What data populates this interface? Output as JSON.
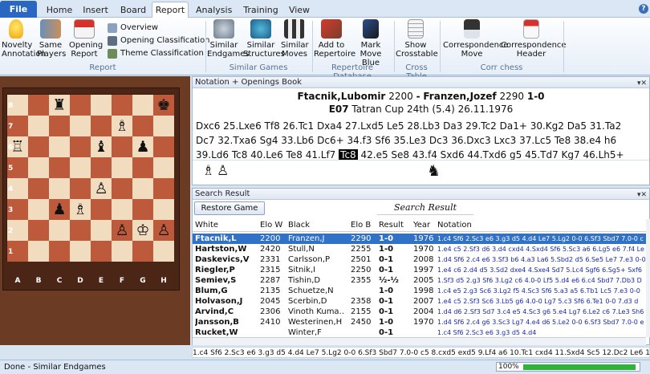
{
  "tabs": [
    "File",
    "Home",
    "Insert",
    "Board",
    "Report",
    "Analysis",
    "Training",
    "View"
  ],
  "help": "?",
  "ribbon": {
    "novelty": "Novelty Annotation",
    "same_players": "Same Players",
    "opening_report": "Opening Report",
    "overview": "Overview",
    "opening_classification": "Opening Classification",
    "theme_classification": "Theme Classification",
    "group_report": "Report",
    "similar_endgames": "Similar Endgames",
    "similar_structures": "Similar Structures",
    "similar_moves": "Similar Moves",
    "group_similar": "Similar Games",
    "add_repertoire": "Add to Repertoire",
    "mark_move_blue": "Mark Move Blue",
    "group_repertoire": "Repertoire Database",
    "show_crosstable": "Show Crosstable",
    "group_cross": "Cross Table",
    "corr_move": "Correspondence Move",
    "corr_header": "Correspondence Header",
    "group_corr": "Corr chess"
  },
  "board": {
    "ranks": [
      "8",
      "7",
      "6",
      "5",
      "4",
      "3",
      "2",
      "1"
    ],
    "files": [
      "A",
      "B",
      "C",
      "D",
      "E",
      "F",
      "G",
      "H"
    ]
  },
  "notation": {
    "title": "Notation + Openings Book",
    "white": "Ftacnik,Lubomir",
    "welo": "2200",
    "sep": "-",
    "black": "Franzen,Jozef",
    "belo": "2290",
    "result": "1-0",
    "eco": "E07",
    "event": "Tatran Cup 24th (5.4) 26.11.1976",
    "moves_a": "Dxc6 25.Lxe6 Tf8 26.Tc1 Dxa4 27.Lxd5 Le5 28.Lb3 Da3 29.Tc2 Da1+ 30.Kg2 Da5 31.Ta2",
    "moves_b": "Dc7 32.Txa6 Sg4 33.Lb6 Dc6+ 34.f3 Sf6 35.Le3 Dc3 36.Dxc3 Lxc3 37.Lc5 Te8 38.e4 h6",
    "moves_c1": "39.Ld6 Tc8 40.Le6 Te8 41.Lf7",
    "current": "Tc8",
    "moves_c2": "42.e5 Se8 43.f4 Sxd6 44.Txd6 g5 45.Td7 Kg7 46.Lh5+"
  },
  "search": {
    "title": "Search Result",
    "restore": "Restore Game",
    "result_title": "Search Result",
    "columns": [
      "White",
      "Elo W",
      "Black",
      "Elo B",
      "Result",
      "Year",
      "Notation"
    ],
    "rows": [
      [
        "Ftacnik,L",
        "2200",
        "Franzen,J",
        "2290",
        "1-0",
        "1976",
        "1.c4 Sf6 2.Sc3 e6 3.g3 d5 4.d4 Le7 5.Lg2 0-0 6.Sf3 Sbd7 7.0-0 c"
      ],
      [
        "Hartston,W",
        "2420",
        "Stull,N",
        "2255",
        "1-0",
        "1970",
        "1.e4 c5 2.Sf3 d6 3.d4 cxd4 4.Sxd4 Sf6 5.Sc3 a6 6.Lg5 e6 7.f4 Le"
      ],
      [
        "Daskevics,V",
        "2331",
        "Carlsson,P",
        "2501",
        "0-1",
        "2008",
        "1.d4 Sf6 2.c4 e6 3.Sf3 b6 4.a3 La6 5.Sbd2 d5 6.Se5 Le7 7.e3 0-0"
      ],
      [
        "Riegler,P",
        "2315",
        "Sitnik,I",
        "2250",
        "0-1",
        "1997",
        "1.e4 c6 2.d4 d5 3.Sd2 dxe4 4.Sxe4 Sd7 5.Lc4 Sgf6 6.Sg5+ Sxf6"
      ],
      [
        "Semiev,S",
        "2287",
        "Tishin,D",
        "2355",
        "½-½",
        "2005",
        "1.Sf3 d5 2.g3 Sf6 3.Lg2 c6 4.0-0 Lf5 5.d4 e6 6.c4 Sbd7 7.Db3 D"
      ],
      [
        "Blum,G",
        "2135",
        "Schuetze,N",
        "",
        "1-0",
        "1998",
        "1.c4 e5 2.g3 Sc6 3.Lg2 f5 4.Sc3 Sf6 5.a3 a5 6.Tb1 Lc5 7.e3 0-0"
      ],
      [
        "Holvason,J",
        "2045",
        "Scerbin,D",
        "2358",
        "0-1",
        "2007",
        "1.e4 c5 2.Sf3 Sc6 3.Lb5 g6 4.0-0 Lg7 5.c3 Sf6 6.Te1 0-0 7.d3 d"
      ],
      [
        "Arvind,C",
        "2306",
        "Vinoth Kuma..",
        "2155",
        "0-1",
        "2004",
        "1.d4 d6 2.Sf3 Sd7 3.c4 e5 4.Sc3 g6 5.e4 Lg7 6.Le2 c6 7.Le3 Sh6"
      ],
      [
        "Jansson,B",
        "2410",
        "Westerinen,H",
        "2450",
        "1-0",
        "1970",
        "1.d4 Sf6 2.c4 g6 3.Sc3 Lg7 4.e4 d6 5.Le2 0-0 6.Sf3 Sbd7 7.0-0 e"
      ],
      [
        "Rucket,W",
        "",
        "Winter,F",
        "",
        "0-1",
        "",
        "1.c4 Sf6 2.Sc3 e6 3.g3 d5 4.d4"
      ]
    ],
    "bottom": "1.c4 Sf6 2.Sc3 e6 3.g3 d5 4.d4 Le7 5.Lg2 0-0 6.Sf3 Sbd7 7.0-0 c5 8.cxd5 exd5 9.Lf4 a6 10.Tc1 cxd4 11.Sxd4 Sc5 12.Dc2 Le6 13.b4 Scd7 14.Sxe6"
  },
  "status": {
    "text": "Done - Similar Endgames",
    "progress_label": "100%",
    "progress": 1.0
  },
  "colors": {
    "selection": "#2f72c8",
    "board_dark": "#bd5a3c",
    "board_light": "#f1dcc0",
    "frame": "#6b3b24"
  }
}
